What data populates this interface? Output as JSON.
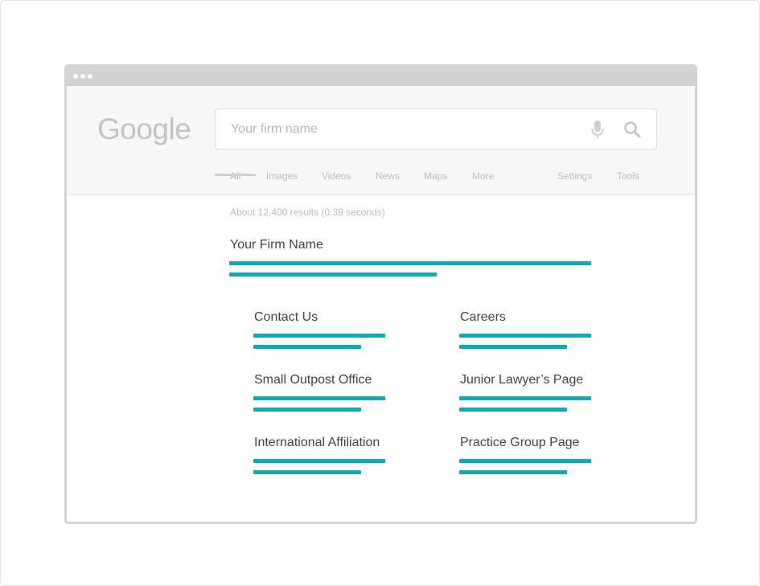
{
  "search": {
    "logo_text": "Google",
    "placeholder": "Your firm name",
    "value": ""
  },
  "tabs": {
    "all": "All",
    "images": "Images",
    "videos": "Videos",
    "news": "News",
    "maps": "Maps",
    "more": "More",
    "settings": "Settings",
    "tools": "Tools"
  },
  "results": {
    "stats": "About 12,400 results (0.39 seconds)",
    "main_title": "Your Firm Name",
    "sitelinks": [
      {
        "title": "Contact Us"
      },
      {
        "title": "Careers"
      },
      {
        "title": "Small Outpost Office"
      },
      {
        "title": "Junior Lawyer’s Page"
      },
      {
        "title": "International Affiliation"
      },
      {
        "title": "Practice Group Page"
      }
    ]
  },
  "icons": {
    "mic": "microphone-icon",
    "search": "magnifier-icon"
  },
  "colors": {
    "accent": "#11a8b8",
    "logo": "#c4c4c4",
    "chrome": "#d3d3d3",
    "header_bg": "#f7f7f7",
    "muted_text": "#bdbdbd",
    "title_text": "#444444"
  }
}
